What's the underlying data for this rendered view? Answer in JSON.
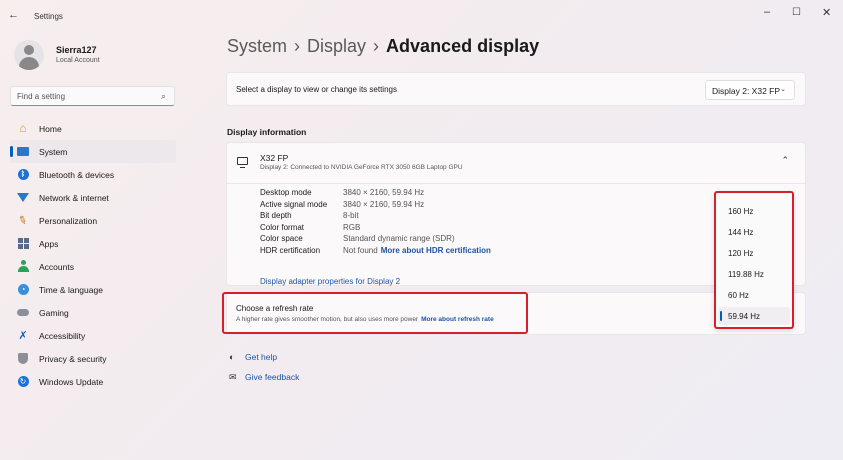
{
  "window": {
    "back_icon": "←",
    "title": "Settings",
    "min_icon": "–",
    "max_icon": "☐",
    "close_icon": "✕"
  },
  "profile": {
    "name": "Sierra127",
    "type": "Local Account"
  },
  "search": {
    "placeholder": "Find a setting",
    "icon": "⌕"
  },
  "nav": {
    "items": [
      {
        "label": "Home",
        "icon": "home-icon"
      },
      {
        "label": "System",
        "icon": "system-icon",
        "selected": true
      },
      {
        "label": "Bluetooth & devices",
        "icon": "bluetooth-icon"
      },
      {
        "label": "Network & internet",
        "icon": "wifi-icon"
      },
      {
        "label": "Personalization",
        "icon": "brush-icon"
      },
      {
        "label": "Apps",
        "icon": "apps-icon"
      },
      {
        "label": "Accounts",
        "icon": "person-icon"
      },
      {
        "label": "Time & language",
        "icon": "globe-icon"
      },
      {
        "label": "Gaming",
        "icon": "controller-icon"
      },
      {
        "label": "Accessibility",
        "icon": "accessibility-icon"
      },
      {
        "label": "Privacy & security",
        "icon": "shield-icon"
      },
      {
        "label": "Windows Update",
        "icon": "update-icon"
      }
    ]
  },
  "breadcrumb": {
    "items": [
      "System",
      "Display",
      "Advanced display"
    ],
    "separator": "›"
  },
  "select_display": {
    "label": "Select a display to view or change its settings",
    "value": "Display 2: X32 FP",
    "chevron": "⌄"
  },
  "display_info": {
    "section_title": "Display information",
    "monitor_name": "X32 FP",
    "monitor_sub": "Display 2: Connected to NVIDIA GeForce RTX 3050 6GB Laptop GPU",
    "chevron": "⌃",
    "rows": [
      {
        "key": "Desktop mode",
        "value": "3840 × 2160, 59.94 Hz"
      },
      {
        "key": "Active signal mode",
        "value": "3840 × 2160, 59.94 Hz"
      },
      {
        "key": "Bit depth",
        "value": "8-bit"
      },
      {
        "key": "Color format",
        "value": "RGB"
      },
      {
        "key": "Color space",
        "value": "Standard dynamic range (SDR)"
      },
      {
        "key": "HDR certification",
        "value": "Not found",
        "link": "More about HDR certification"
      }
    ],
    "adapter_link": "Display adapter properties for Display 2"
  },
  "refresh": {
    "title": "Choose a refresh rate",
    "subtitle": "A higher rate gives smoother motion, but also uses more power",
    "link": "More about refresh rate",
    "options": [
      "160 Hz",
      "144 Hz",
      "120 Hz",
      "119.88 Hz",
      "60 Hz",
      "59.94 Hz"
    ],
    "selected": "59.94 Hz"
  },
  "footer": {
    "help": "Get help",
    "feedback": "Give feedback"
  },
  "colors": {
    "accent": "#005fb8",
    "link": "#1a54a6",
    "highlight": "#d61f2c"
  }
}
